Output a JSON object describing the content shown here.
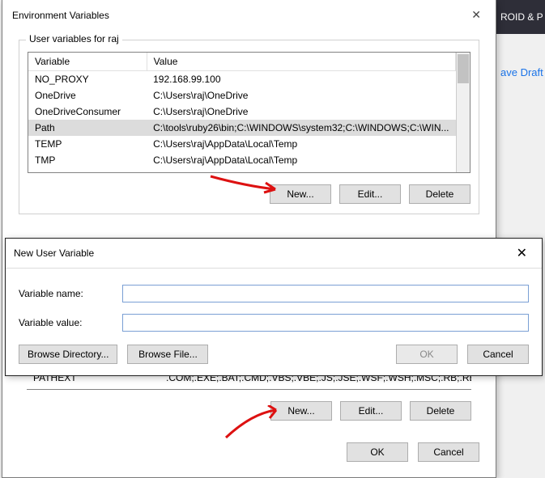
{
  "bg": {
    "header_frag": "ROID & P",
    "save_draft": "ave Draft"
  },
  "env": {
    "title": "Environment Variables",
    "user_group": "User variables for raj",
    "col_var": "Variable",
    "col_val": "Value",
    "rows": [
      {
        "name": "NO_PROXY",
        "value": "192.168.99.100",
        "selected": false
      },
      {
        "name": "OneDrive",
        "value": "C:\\Users\\raj\\OneDrive",
        "selected": false
      },
      {
        "name": "OneDriveConsumer",
        "value": "C:\\Users\\raj\\OneDrive",
        "selected": false
      },
      {
        "name": "Path",
        "value": "C:\\tools\\ruby26\\bin;C:\\WINDOWS\\system32;C:\\WINDOWS;C:\\WIN...",
        "selected": true
      },
      {
        "name": "TEMP",
        "value": "C:\\Users\\raj\\AppData\\Local\\Temp",
        "selected": false
      },
      {
        "name": "TMP",
        "value": "C:\\Users\\raj\\AppData\\Local\\Temp",
        "selected": false
      }
    ],
    "new": "New...",
    "edit": "Edit...",
    "delete": "Delete",
    "sys_row": {
      "name": "PATHEXT",
      "value": ".COM;.EXE;.BAT;.CMD;.VBS;.VBE;.JS;.JSE;.WSF;.WSH;.MSC;.RB;.RBW"
    },
    "ok": "OK",
    "cancel": "Cancel"
  },
  "newvar": {
    "title": "New User Variable",
    "name_label": "Variable name:",
    "value_label": "Variable value:",
    "name_value": "",
    "value_value": "",
    "browse_dir": "Browse Directory...",
    "browse_file": "Browse File...",
    "ok": "OK",
    "cancel": "Cancel"
  }
}
